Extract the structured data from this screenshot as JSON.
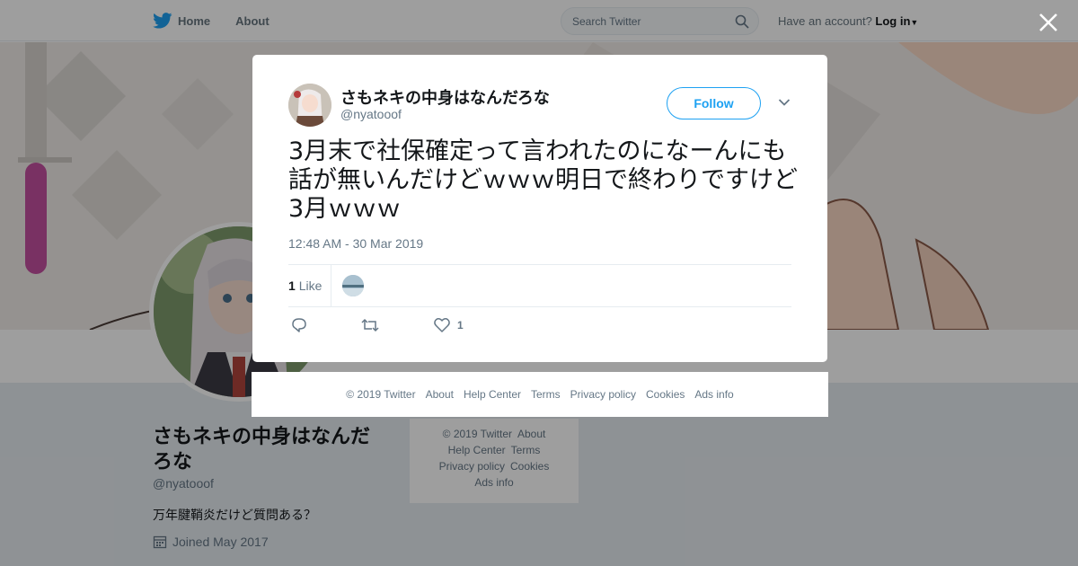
{
  "topbar": {
    "nav": [
      {
        "label": "Home"
      },
      {
        "label": "About"
      }
    ],
    "search_placeholder": "Search Twitter",
    "account_prompt": "Have an account?",
    "login_label": "Log in"
  },
  "profile": {
    "name": "さもネキの中身はなんだろな",
    "handle": "@nyatooof",
    "bio": "万年腱鞘炎だけど質問ある？",
    "joined": "Joined May 2017"
  },
  "side_footer": {
    "copyright": "© 2019 Twitter",
    "links": [
      "About",
      "Help Center",
      "Terms",
      "Privacy policy",
      "Cookies",
      "Ads info"
    ]
  },
  "modal": {
    "name": "さもネキの中身はなんだろな",
    "handle": "@nyatooof",
    "follow_label": "Follow",
    "text": "3月末で社保確定って言われたのになーんにも話が無いんだけどｗｗｗ明日で終わりですけど3月ｗｗｗ",
    "timestamp": "12:48 AM - 30 Mar 2019",
    "like_count": "1",
    "like_label": "Like",
    "action_like_count": "1"
  },
  "modal_footer": {
    "copyright": "© 2019 Twitter",
    "links": [
      "About",
      "Help Center",
      "Terms",
      "Privacy policy",
      "Cookies",
      "Ads info"
    ]
  },
  "colors": {
    "accent": "#1da1f2",
    "muted_text": "#657786",
    "banner_pink": "#c44fa0"
  }
}
